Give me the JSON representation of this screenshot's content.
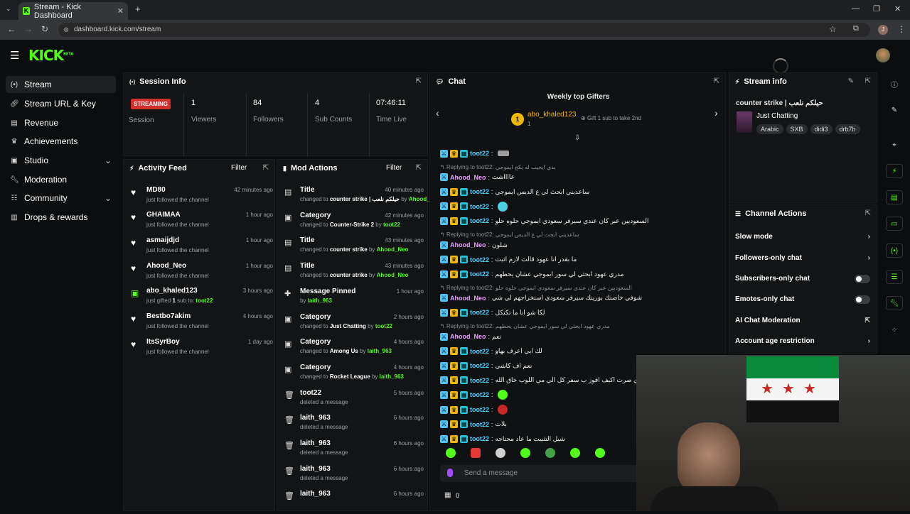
{
  "browser": {
    "tab_title": "Stream - Kick Dashboard",
    "url": "dashboard.kick.com/stream",
    "new_tab": "+",
    "profile_initial": "J"
  },
  "brand": {
    "logo": "KICK",
    "beta": "BETA",
    "accent": "#53fc18"
  },
  "sidebar": {
    "items": [
      {
        "label": "Stream",
        "icon": "broadcast-icon",
        "active": true
      },
      {
        "label": "Stream URL & Key",
        "icon": "link-icon"
      },
      {
        "label": "Revenue",
        "icon": "revenue-icon"
      },
      {
        "label": "Achievements",
        "icon": "trophy-icon"
      },
      {
        "label": "Studio",
        "icon": "studio-icon",
        "chevron": true
      },
      {
        "label": "Moderation",
        "icon": "wrench-icon"
      },
      {
        "label": "Community",
        "icon": "community-icon",
        "chevron": true
      },
      {
        "label": "Drops & rewards",
        "icon": "gift-icon"
      }
    ]
  },
  "session": {
    "title": "Session Info",
    "badge": "STREAMING",
    "session_label": "Session",
    "stats": [
      {
        "value": "1",
        "label": "Viewers"
      },
      {
        "value": "84",
        "label": "Followers"
      },
      {
        "value": "4",
        "label": "Sub Counts"
      },
      {
        "value": "07:46:11",
        "label": "Time Live"
      }
    ]
  },
  "activity": {
    "title": "Activity Feed",
    "filter": "Filter",
    "items": [
      {
        "name": "MD80",
        "sub": "just followed the channel",
        "time": "42 minutes ago",
        "icon": "heart-icon"
      },
      {
        "name": "GHAIMAA",
        "sub": "just followed the channel",
        "time": "1 hour ago",
        "icon": "heart-icon"
      },
      {
        "name": "asmaijdjd",
        "sub": "just followed the channel",
        "time": "1 hour ago",
        "icon": "heart-icon"
      },
      {
        "name": "Ahood_Neo",
        "sub": "just followed the channel",
        "time": "1 hour ago",
        "icon": "heart-icon"
      },
      {
        "name": "abo_khaled123",
        "sub_pre": "just gifted",
        "sub_num": "1",
        "sub_mid": "sub to:",
        "sub_user": "toot22",
        "time": "3 hours ago",
        "icon": "gift-icon"
      },
      {
        "name": "Bestbo7akim",
        "sub": "just followed the channel",
        "time": "4 hours ago",
        "icon": "heart-icon"
      },
      {
        "name": "ItsSyrBoy",
        "sub": "just followed the channel",
        "time": "1 day ago",
        "icon": "heart-icon"
      }
    ]
  },
  "mod": {
    "title": "Mod Actions",
    "filter": "Filter",
    "items": [
      {
        "title": "Title",
        "pre": "changed to",
        "value": "counter strike | حيلكم نلعب",
        "by": "by",
        "user": "Ahood_Neo",
        "time": "40 minutes ago",
        "icon": "title-icon"
      },
      {
        "title": "Category",
        "pre": "changed to",
        "value": "Counter-Strike 2",
        "by": "by",
        "user": "toot22",
        "time": "42 minutes ago",
        "icon": "category-icon"
      },
      {
        "title": "Title",
        "pre": "changed to",
        "value": "counter strike",
        "by": "by",
        "user": "Ahood_Neo",
        "time": "43 minutes ago",
        "icon": "title-icon"
      },
      {
        "title": "Title",
        "pre": "changed to",
        "value": "counter strike",
        "by": "by",
        "user": "Ahood_Neo",
        "time": "43 minutes ago",
        "icon": "title-icon"
      },
      {
        "title": "Message Pinned",
        "pre": "",
        "value": "",
        "by": "by",
        "user": "laith_963",
        "time": "1 hour ago",
        "icon": "pin-icon"
      },
      {
        "title": "Category",
        "pre": "changed to",
        "value": "Just Chatting",
        "by": "by",
        "user": "toot22",
        "time": "2 hours ago",
        "icon": "category-icon"
      },
      {
        "title": "Category",
        "pre": "changed to",
        "value": "Among Us",
        "by": "by",
        "user": "laith_963",
        "time": "4 hours ago",
        "icon": "category-icon"
      },
      {
        "title": "Category",
        "pre": "changed to",
        "value": "Rocket League",
        "by": "by",
        "user": "laith_963",
        "time": "4 hours ago",
        "icon": "category-icon"
      },
      {
        "title": "toot22",
        "pre": "deleted a message",
        "value": "",
        "by": "",
        "user": "",
        "time": "5 hours ago",
        "icon": "trash-icon"
      },
      {
        "title": "laith_963",
        "pre": "deleted a message",
        "value": "",
        "by": "",
        "user": "",
        "time": "6 hours ago",
        "icon": "trash-icon"
      },
      {
        "title": "laith_963",
        "pre": "deleted a message",
        "value": "",
        "by": "",
        "user": "",
        "time": "6 hours ago",
        "icon": "trash-icon"
      },
      {
        "title": "laith_963",
        "pre": "deleted a message",
        "value": "",
        "by": "",
        "user": "",
        "time": "6 hours ago",
        "icon": "trash-icon"
      },
      {
        "title": "laith_963",
        "pre": "",
        "value": "",
        "by": "",
        "user": "",
        "time": "6 hours ago",
        "icon": "trash-icon"
      }
    ]
  },
  "chat": {
    "title": "Chat",
    "gifters_title": "Weekly top Gifters",
    "top_gifter": "abo_khaled123",
    "top_gifter_count": "1",
    "gift_hint": "Gift 1 sub to take 2nd",
    "placeholder": "Send a message",
    "count": "0",
    "messages": [
      {
        "type": "msg",
        "user": "toot22",
        "text": "",
        "emoji": "knife"
      },
      {
        "type": "reply",
        "text": "Replying to toot22: بدي ايجيب له يكج ايموجي"
      },
      {
        "type": "msg",
        "user": "Ahood_Neo",
        "text": "عااااشت",
        "color": "ahood"
      },
      {
        "type": "msg",
        "user": "toot22",
        "text": "ساعديني ابحث لي ع الديس ايموجي"
      },
      {
        "type": "msg",
        "user": "toot22",
        "text": "",
        "emoji": "cyan"
      },
      {
        "type": "msg",
        "user": "toot22",
        "text": "السعوديين عبر كان عندي سيرفر سعودي ايموجي حلوه حلو"
      },
      {
        "type": "reply",
        "text": "Replying to toot22: ساعديني ابحث لي ع الديس ايموجي"
      },
      {
        "type": "msg",
        "user": "Ahood_Neo",
        "text": "شلون",
        "color": "ahood"
      },
      {
        "type": "msg",
        "user": "toot22",
        "text": "ما بقدر انا عهود قالت لازم اثبت"
      },
      {
        "type": "msg",
        "user": "toot22",
        "text": "مدري عهود ابحثي لي سور ايموجي عشان يحطهم"
      },
      {
        "type": "reply",
        "text": "Replying to toot22: السعوديين عبر كان عندي سيرفر سعودي ايموجي حلوه حلو"
      },
      {
        "type": "msg",
        "user": "Ahood_Neo",
        "text": "شوفي خاصتك بورينك سيرفر سعودي استخراجهم لي شي",
        "color": "ahood"
      },
      {
        "type": "msg",
        "user": "toot22",
        "text": "لكا شو انا ما تكتكل"
      },
      {
        "type": "reply",
        "text": "Replying to toot22: مدري عهود ابحثي لي سور ايموجي عشان يحطهم"
      },
      {
        "type": "msg",
        "user": "Ahood_Neo",
        "text": "تعم",
        "color": "ahood"
      },
      {
        "type": "msg",
        "user": "toot22",
        "text": "لك ابي اعرف بهاو"
      },
      {
        "type": "msg",
        "user": "toot22",
        "text": "نعم اف كاشي"
      },
      {
        "type": "msg",
        "user": "toot22",
        "text": "كل يا فوري صرت اكيف افوز ب سفر كل الي مي اللوب خاق الله"
      },
      {
        "type": "msg",
        "user": "toot22",
        "text": "",
        "emoji": "green"
      },
      {
        "type": "msg",
        "user": "toot22",
        "text": "",
        "emoji": "face"
      },
      {
        "type": "msg",
        "user": "toot22",
        "text": "بلات"
      },
      {
        "type": "msg",
        "user": "toot22",
        "text": "شيل التثبيت ما عاد محتاجه"
      }
    ]
  },
  "stream_info": {
    "title": "Stream info",
    "stream_title": "counter strike | حيلكم نلعب",
    "category": "Just Chatting",
    "tags": [
      "Arabic",
      "SXB",
      "didi3",
      "drb7h"
    ]
  },
  "channel_actions": {
    "title": "Channel Actions",
    "items": [
      {
        "label": "Slow mode",
        "control": "arrow"
      },
      {
        "label": "Followers-only chat",
        "control": "arrow"
      },
      {
        "label": "Subscribers-only chat",
        "control": "toggle"
      },
      {
        "label": "Emotes-only chat",
        "control": "toggle"
      },
      {
        "label": "AI Chat Moderation",
        "control": "external"
      },
      {
        "label": "Account age restriction",
        "control": "arrow"
      }
    ]
  }
}
